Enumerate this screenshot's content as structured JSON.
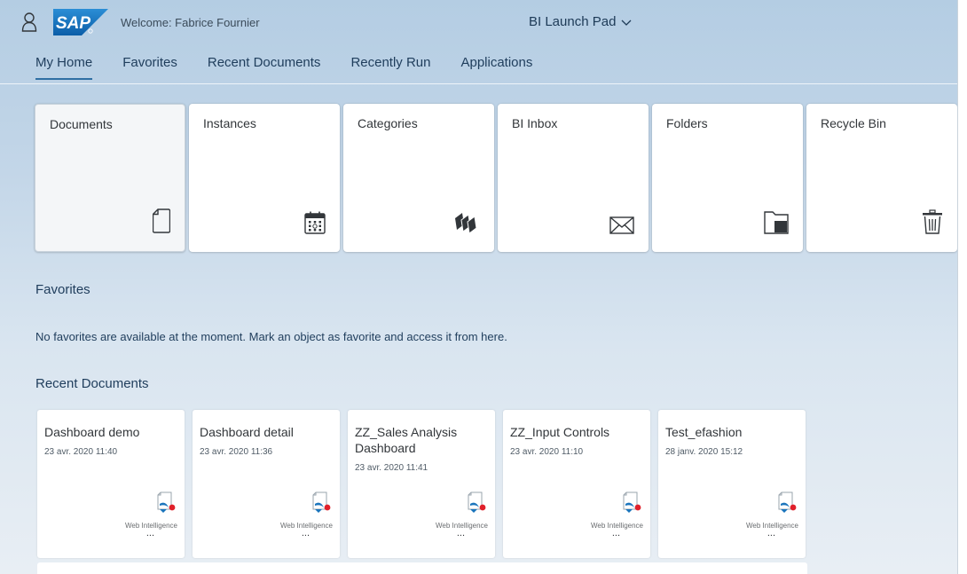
{
  "shell": {
    "logo_text": "SAP",
    "welcome": "Welcome: Fabrice Fournier",
    "app_title": "BI Launch Pad"
  },
  "tabs": [
    {
      "label": "My Home",
      "active": true
    },
    {
      "label": "Favorites",
      "active": false
    },
    {
      "label": "Recent Documents",
      "active": false
    },
    {
      "label": "Recently Run",
      "active": false
    },
    {
      "label": "Applications",
      "active": false
    }
  ],
  "tiles": [
    {
      "label": "Documents",
      "icon": "document-icon"
    },
    {
      "label": "Instances",
      "icon": "calendar-icon"
    },
    {
      "label": "Categories",
      "icon": "categories-icon"
    },
    {
      "label": "BI Inbox",
      "icon": "envelope-icon"
    },
    {
      "label": "Folders",
      "icon": "folder-icon"
    },
    {
      "label": "Recycle Bin",
      "icon": "trash-icon"
    }
  ],
  "favorites": {
    "title": "Favorites",
    "empty_message": "No favorites are available at the moment. Mark an object as favorite and access it from here."
  },
  "recent": {
    "title": "Recent Documents",
    "items": [
      {
        "title": "Dashboard demo",
        "date": "23 avr. 2020 11:40",
        "type": "Web Intelligence",
        "more": "..."
      },
      {
        "title": "Dashboard detail",
        "date": "23 avr. 2020 11:36",
        "type": "Web Intelligence",
        "more": "..."
      },
      {
        "title": "ZZ_Sales Analysis Dashboard",
        "date": "23 avr. 2020 11:41",
        "type": "Web Intelligence",
        "more": "..."
      },
      {
        "title": "ZZ_Input Controls",
        "date": "23 avr. 2020 11:10",
        "type": "Web Intelligence",
        "more": "..."
      },
      {
        "title": "Test_efashion",
        "date": "28 janv. 2020 15:12",
        "type": "Web Intelligence",
        "more": "..."
      }
    ]
  },
  "colors": {
    "accent": "#2f6fa3",
    "sap_blue": "#1b75bc",
    "webi_red": "#e0202a"
  }
}
